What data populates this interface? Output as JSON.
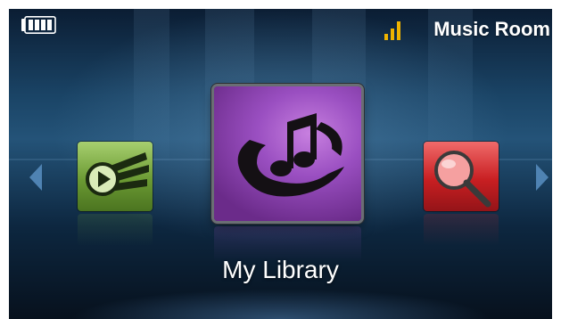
{
  "status_bar": {
    "battery_icon": "battery-icon",
    "signal_icon": "signal-strength-icon",
    "room_name": "Music Room"
  },
  "carousel": {
    "items": [
      {
        "id": "now-playing",
        "icon": "play-menu-icon",
        "color": "#6b9a33"
      },
      {
        "id": "my-library",
        "icon": "music-note-icon",
        "color": "#9a4fc1",
        "selected": true
      },
      {
        "id": "search",
        "icon": "magnifier-icon",
        "color": "#c81f22"
      }
    ],
    "selected_label": "My Library",
    "prev_icon": "arrow-left-icon",
    "next_icon": "arrow-right-icon"
  },
  "colors": {
    "background": "#1a4466",
    "text": "#ffffff",
    "signal": "#f0b400"
  }
}
